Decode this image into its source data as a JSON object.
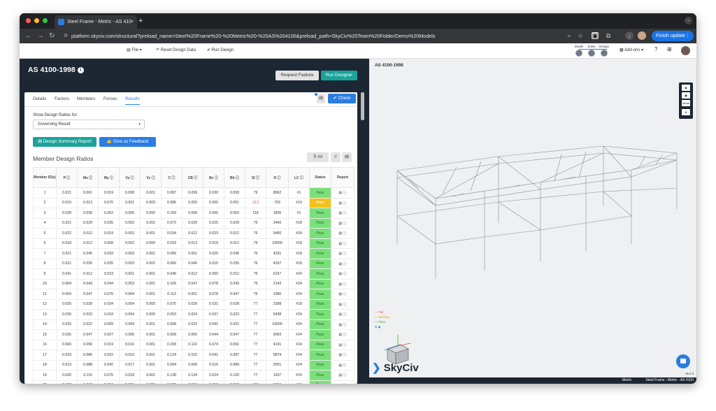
{
  "browser": {
    "tab_title": "Steel Frame - Metric - AS 410",
    "tab_close": "×",
    "new_tab": "+",
    "url": "platform.skyciv.com/structural?preload_name=Steel%20Frame%20-%20Metric%20-%20AS%204100&preload_path=SkyCiv%20Team%20Folder/Demo%20Models",
    "finish_update": "Finish update"
  },
  "appbar": {
    "file": "File",
    "reset": "Reset Design Data",
    "run": "Run Design",
    "modes": [
      "Model",
      "Solve",
      "Design"
    ],
    "addons": "Add-ons"
  },
  "left": {
    "title": "AS 4100-1998",
    "request_feature": "Request Feature",
    "run_designer": "Run Designer",
    "tabs": [
      "Details",
      "Factors",
      "Members",
      "Forces",
      "Results"
    ],
    "check": "Check",
    "show_label": "Show Design Ratios for:",
    "select_value": "Governing Result",
    "summary_btn": "Design Summary Report",
    "feedback_btn": "Give us Feedback",
    "section_title": "Member Design Ratios",
    "filter_all": "All"
  },
  "table": {
    "headers": [
      "Member ID(s)",
      "P",
      "Mx",
      "My",
      "Vy",
      "Vz",
      "C",
      "CB",
      "Bc",
      "Bb",
      "Sl",
      "D",
      "LC",
      "Status",
      "Report"
    ],
    "rows": [
      [
        "1",
        "0.021",
        "0.061",
        "0.019",
        "0.008",
        "0.001",
        "0.087",
        "0.099",
        "0.030",
        "0.093",
        "79",
        "8962",
        "#1",
        "Pass"
      ],
      [
        "2",
        "0.010",
        "0.013",
        "0.076",
        "0.001",
        "0.003",
        "0.085",
        "0.055",
        "0.065",
        "0.051",
        "213",
        "793",
        "#19",
        "Warn"
      ],
      [
        "3",
        "0.028",
        "0.036",
        "0.052",
        "0.005",
        "0.000",
        "0.109",
        "0.068",
        "0.065",
        "0.063",
        "118",
        "1836",
        "#1",
        "Pass"
      ],
      [
        "4",
        "0.021",
        "0.029",
        "0.035",
        "0.002",
        "0.001",
        "0.072",
        "0.029",
        "0.025",
        "0.029",
        "76",
        "2466",
        "#18",
        "Pass"
      ],
      [
        "5",
        "0.022",
        "0.012",
        "0.019",
        "0.002",
        "0.001",
        "0.034",
        "0.012",
        "0.023",
        "0.012",
        "76",
        "5460",
        "#24",
        "Pass"
      ],
      [
        "6",
        "0.018",
        "0.012",
        "0.008",
        "0.002",
        "0.000",
        "0.033",
        "0.013",
        "0.018",
        "0.012",
        "76",
        "10000",
        "#18",
        "Pass"
      ],
      [
        "7",
        "0.021",
        "0.045",
        "0.033",
        "0.003",
        "0.001",
        "0.089",
        "0.051",
        "0.025",
        "0.045",
        "76",
        "4331",
        "#18",
        "Pass"
      ],
      [
        "8",
        "0.021",
        "0.035",
        "0.035",
        "0.003",
        "0.002",
        "0.066",
        "0.040",
        "0.015",
        "0.035",
        "76",
        "4337",
        "#18",
        "Pass"
      ],
      [
        "9",
        "0.041",
        "0.012",
        "0.023",
        "0.001",
        "0.001",
        "0.049",
        "0.012",
        "0.050",
        "0.012",
        "76",
        "6157",
        "#24",
        "Pass"
      ],
      [
        "10",
        "0.064",
        "0.043",
        "0.044",
        "0.003",
        "0.001",
        "0.109",
        "0.047",
        "0.078",
        "0.043",
        "76",
        "2143",
        "#24",
        "Pass"
      ],
      [
        "11",
        "0.064",
        "0.047",
        "0.076",
        "0.004",
        "0.001",
        "0.113",
        "0.051",
        "0.078",
        "0.047",
        "76",
        "1080",
        "#24",
        "Pass"
      ],
      [
        "12",
        "0.025",
        "0.028",
        "0.034",
        "0.004",
        "0.000",
        "0.075",
        "0.029",
        "0.031",
        "0.028",
        "77",
        "2398",
        "#18",
        "Pass"
      ],
      [
        "13",
        "0.030",
        "0.023",
        "0.018",
        "0.004",
        "0.000",
        "0.053",
        "0.024",
        "0.037",
        "0.023",
        "77",
        "5438",
        "#24",
        "Pass"
      ],
      [
        "14",
        "0.033",
        "0.022",
        "0.009",
        "0.004",
        "0.001",
        "0.058",
        "0.023",
        "0.041",
        "0.022",
        "77",
        "10000",
        "#24",
        "Pass"
      ],
      [
        "15",
        "0.036",
        "0.047",
        "0.027",
        "0.005",
        "0.001",
        "0.099",
        "0.056",
        "0.044",
        "0.047",
        "77",
        "9093",
        "#24",
        "Pass"
      ],
      [
        "16",
        "0.060",
        "0.090",
        "0.019",
        "0.016",
        "0.001",
        "0.158",
        "0.110",
        "0.074",
        "0.091",
        "77",
        "4191",
        "#24",
        "Pass"
      ],
      [
        "17",
        "0.033",
        "0.086",
        "0.022",
        "0.016",
        "0.001",
        "0.124",
        "0.102",
        "0.041",
        "0.087",
        "77",
        "5874",
        "#24",
        "Pass"
      ],
      [
        "18",
        "0.013",
        "0.088",
        "0.042",
        "0.017",
        "0.001",
        "0.094",
        "0.090",
        "0.016",
        "0.089",
        "77",
        "2051",
        "#24",
        "Pass"
      ],
      [
        "19",
        "0.020",
        "0.119",
        "0.076",
        "0.018",
        "0.001",
        "0.138",
        "0.134",
        "0.024",
        "0.120",
        "77",
        "1037",
        "#24",
        "Pass"
      ],
      [
        "20",
        "0.007",
        "0.012",
        "0.010",
        "0.001",
        "0.000",
        "0.025",
        "0.013",
        "0.013",
        "0.013",
        "116",
        "5719",
        "#18",
        "Pass"
      ]
    ]
  },
  "right": {
    "label": "AS 4100-1998",
    "legend": [
      "Fail",
      "Warning",
      "Pass"
    ],
    "views": "Views",
    "logo": "SkyCiv",
    "version": "v6.2.3",
    "status_units": "Metric",
    "status_title": "Steel Frame - Metric - AS 4100"
  }
}
